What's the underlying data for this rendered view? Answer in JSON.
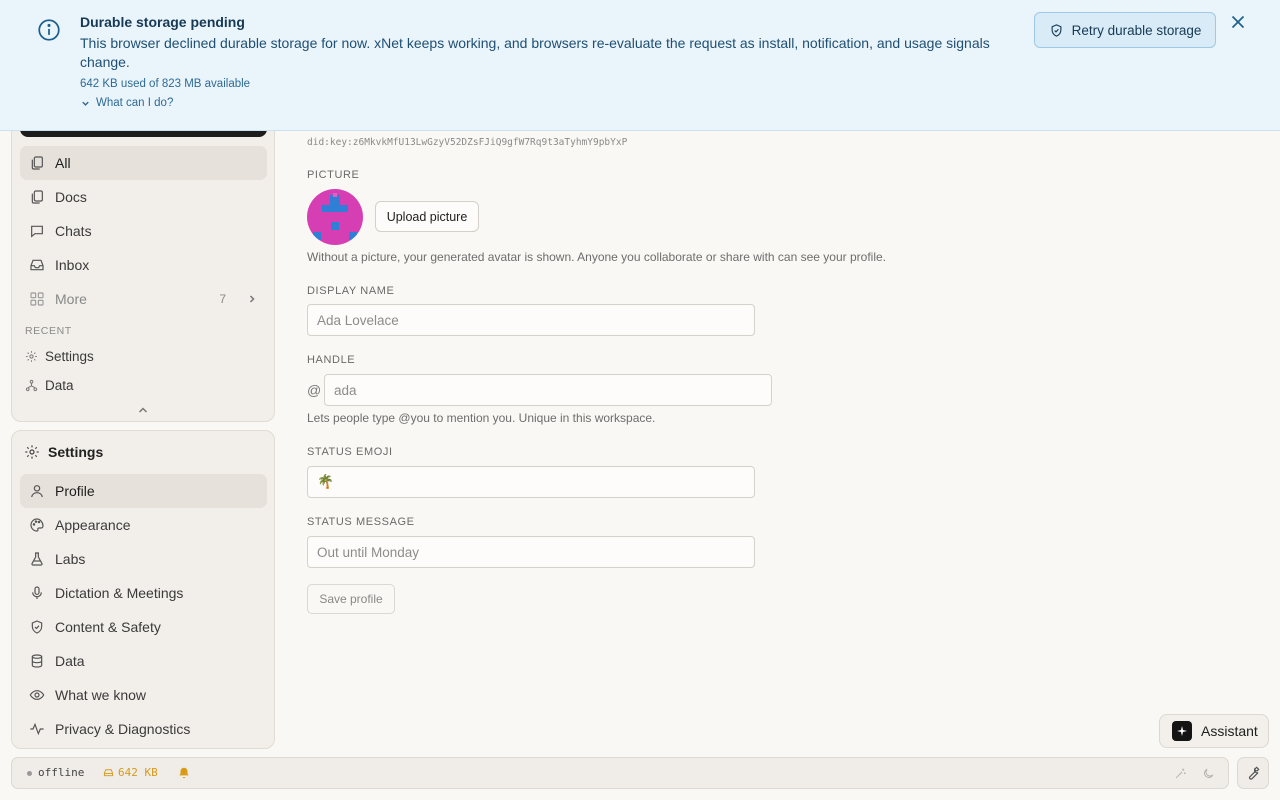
{
  "banner": {
    "title": "Durable storage pending",
    "body": "This browser declined durable storage for now. xNet keeps working, and browsers re-evaluate the request as install, notification, and usage signals change.",
    "usage": "642 KB used of 823 MB available",
    "help_link": "What can I do?",
    "retry_label": "Retry durable storage"
  },
  "nav": {
    "items": [
      {
        "label": "All",
        "icon": "pages-icon"
      },
      {
        "label": "Docs",
        "icon": "doc-icon"
      },
      {
        "label": "Chats",
        "icon": "chat-icon"
      },
      {
        "label": "Inbox",
        "icon": "inbox-icon"
      }
    ],
    "more": {
      "label": "More",
      "count": "7"
    },
    "recent_label": "RECENT",
    "recent": [
      {
        "label": "Settings",
        "icon": "gear-icon"
      },
      {
        "label": "Data",
        "icon": "hierarchy-icon"
      }
    ]
  },
  "settings": {
    "title": "Settings",
    "items": [
      {
        "label": "Profile",
        "icon": "user-icon"
      },
      {
        "label": "Appearance",
        "icon": "palette-icon"
      },
      {
        "label": "Labs",
        "icon": "flask-icon"
      },
      {
        "label": "Dictation & Meetings",
        "icon": "mic-icon"
      },
      {
        "label": "Content & Safety",
        "icon": "shield-icon"
      },
      {
        "label": "Data",
        "icon": "database-icon"
      },
      {
        "label": "What we know",
        "icon": "eye-icon"
      },
      {
        "label": "Privacy & Diagnostics",
        "icon": "activity-icon"
      }
    ]
  },
  "profile": {
    "did": "did:key:z6MkvkMfU13LwGzyV52DZsFJiQ9gfW7Rq9t3aTyhmY9pbYxP",
    "picture_label": "PICTURE",
    "upload_label": "Upload picture",
    "picture_help": "Without a picture, your generated avatar is shown. Anyone you collaborate or share with can see your profile.",
    "display_name_label": "DISPLAY NAME",
    "display_name_placeholder": "Ada Lovelace",
    "handle_label": "HANDLE",
    "handle_prefix": "@",
    "handle_placeholder": "ada",
    "handle_help": "Lets people type @you to mention you. Unique in this workspace.",
    "status_emoji_label": "STATUS EMOJI",
    "status_emoji_value": "🌴",
    "status_message_label": "STATUS MESSAGE",
    "status_message_placeholder": "Out until Monday",
    "save_label": "Save profile"
  },
  "assistant": {
    "label": "Assistant"
  },
  "statusbar": {
    "connection": "offline",
    "storage": "642 KB"
  },
  "colors": {
    "banner_bg": "#eaf4fb",
    "avatar_bg": "#d63fb4",
    "avatar_fg": "#2f7fd6",
    "storage_warn": "#d69a1d"
  }
}
